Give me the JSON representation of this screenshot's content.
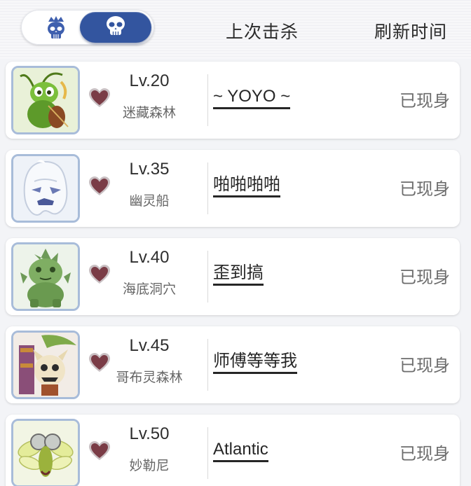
{
  "header": {
    "toggle": {
      "left_icon": "crowned-skull-icon",
      "right_icon": "skull-icon",
      "active": "right"
    },
    "col_last_kill": "上次击杀",
    "col_refresh": "刷新时间"
  },
  "colors": {
    "accent": "#33559f",
    "avatar_border": "#a8bcd9",
    "heart": "#7a3c46"
  },
  "bosses": [
    {
      "avatar_icon": "grasshopper-violinist-icon",
      "level": "Lv.20",
      "zone": "迷藏森林",
      "last_killer": "~ YOYO ~",
      "status": "已现身"
    },
    {
      "avatar_icon": "ghost-icon",
      "level": "Lv.35",
      "zone": "幽灵船",
      "last_killer": "啪啪啪啪",
      "status": "已现身"
    },
    {
      "avatar_icon": "green-cactus-monster-icon",
      "level": "Lv.40",
      "zone": "海底洞穴",
      "last_killer": "歪到搞",
      "status": "已现身"
    },
    {
      "avatar_icon": "goblin-throne-icon",
      "level": "Lv.45",
      "zone": "哥布灵森林",
      "last_killer": "师傅等等我",
      "status": "已现身"
    },
    {
      "avatar_icon": "dragonfly-icon",
      "level": "Lv.50",
      "zone": "妙勒尼",
      "last_killer": "Atlantic",
      "status": "已现身"
    }
  ]
}
